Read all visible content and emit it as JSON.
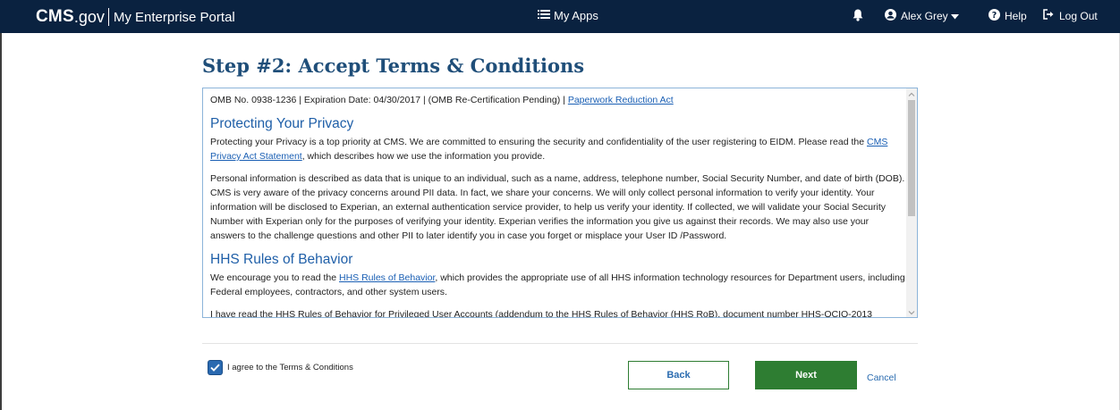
{
  "header": {
    "logo_cms": "CMS",
    "logo_gov": ".gov",
    "portal_name": "My Enterprise Portal",
    "my_apps": "My Apps",
    "user_name": "Alex Grey",
    "help": "Help",
    "logout": "Log Out"
  },
  "page": {
    "title": "Step #2: Accept Terms & Conditions"
  },
  "terms": {
    "omb_line": "OMB No. 0938-1236 | Expiration Date: 04/30/2017 | (OMB Re-Certification Pending) | ",
    "paperwork_link": "Paperwork Reduction Act",
    "privacy_heading": "Protecting Your Privacy",
    "privacy_p1_before": "Protecting your Privacy is a top priority at CMS. We are committed to ensuring the security and confidentiality of the user registering to EIDM. Please read the ",
    "privacy_p1_link": "CMS Privacy Act Statement",
    "privacy_p1_after": ", which describes how we use the information you provide.",
    "privacy_p2": "Personal information is described as data that is unique to an individual, such as a name, address, telephone number, Social Security Number, and date of birth (DOB). CMS is very aware of the privacy concerns around PII data. In fact, we share your concerns. We will only collect personal information to verify your identity. Your information will be disclosed to Experian, an external authentication service provider, to help us verify your identity. If collected, we will validate your Social Security Number with Experian only for the purposes of verifying your identity. Experian verifies the information you give us against their records. We may also use your answers to the challenge questions and other PII to later identify you in case you forget or misplace your User ID /Password.",
    "hhs_heading": "HHS Rules of Behavior",
    "hhs_p1_before": "We encourage you to read the ",
    "hhs_p1_link": "HHS Rules of Behavior",
    "hhs_p1_after": ", which provides the appropriate use of all HHS information technology resources for Department users, including Federal employees, contractors, and other system users.",
    "hhs_p2": "I have read the HHS Rules of Behavior for Privileged User Accounts (addendum to the HHS Rules of Behavior (HHS RoB), document number HHS-OCIO-2013"
  },
  "agree": {
    "label": "I agree to the Terms & Conditions",
    "checked": true
  },
  "actions": {
    "back": "Back",
    "next": "Next",
    "cancel": "Cancel"
  },
  "colors": {
    "header_bg": "#0a2240",
    "title": "#1f4e79",
    "section_heading": "#1f5fa8",
    "link": "#1a5fb4",
    "primary_button": "#2e7d32",
    "checkbox": "#2969b0"
  }
}
